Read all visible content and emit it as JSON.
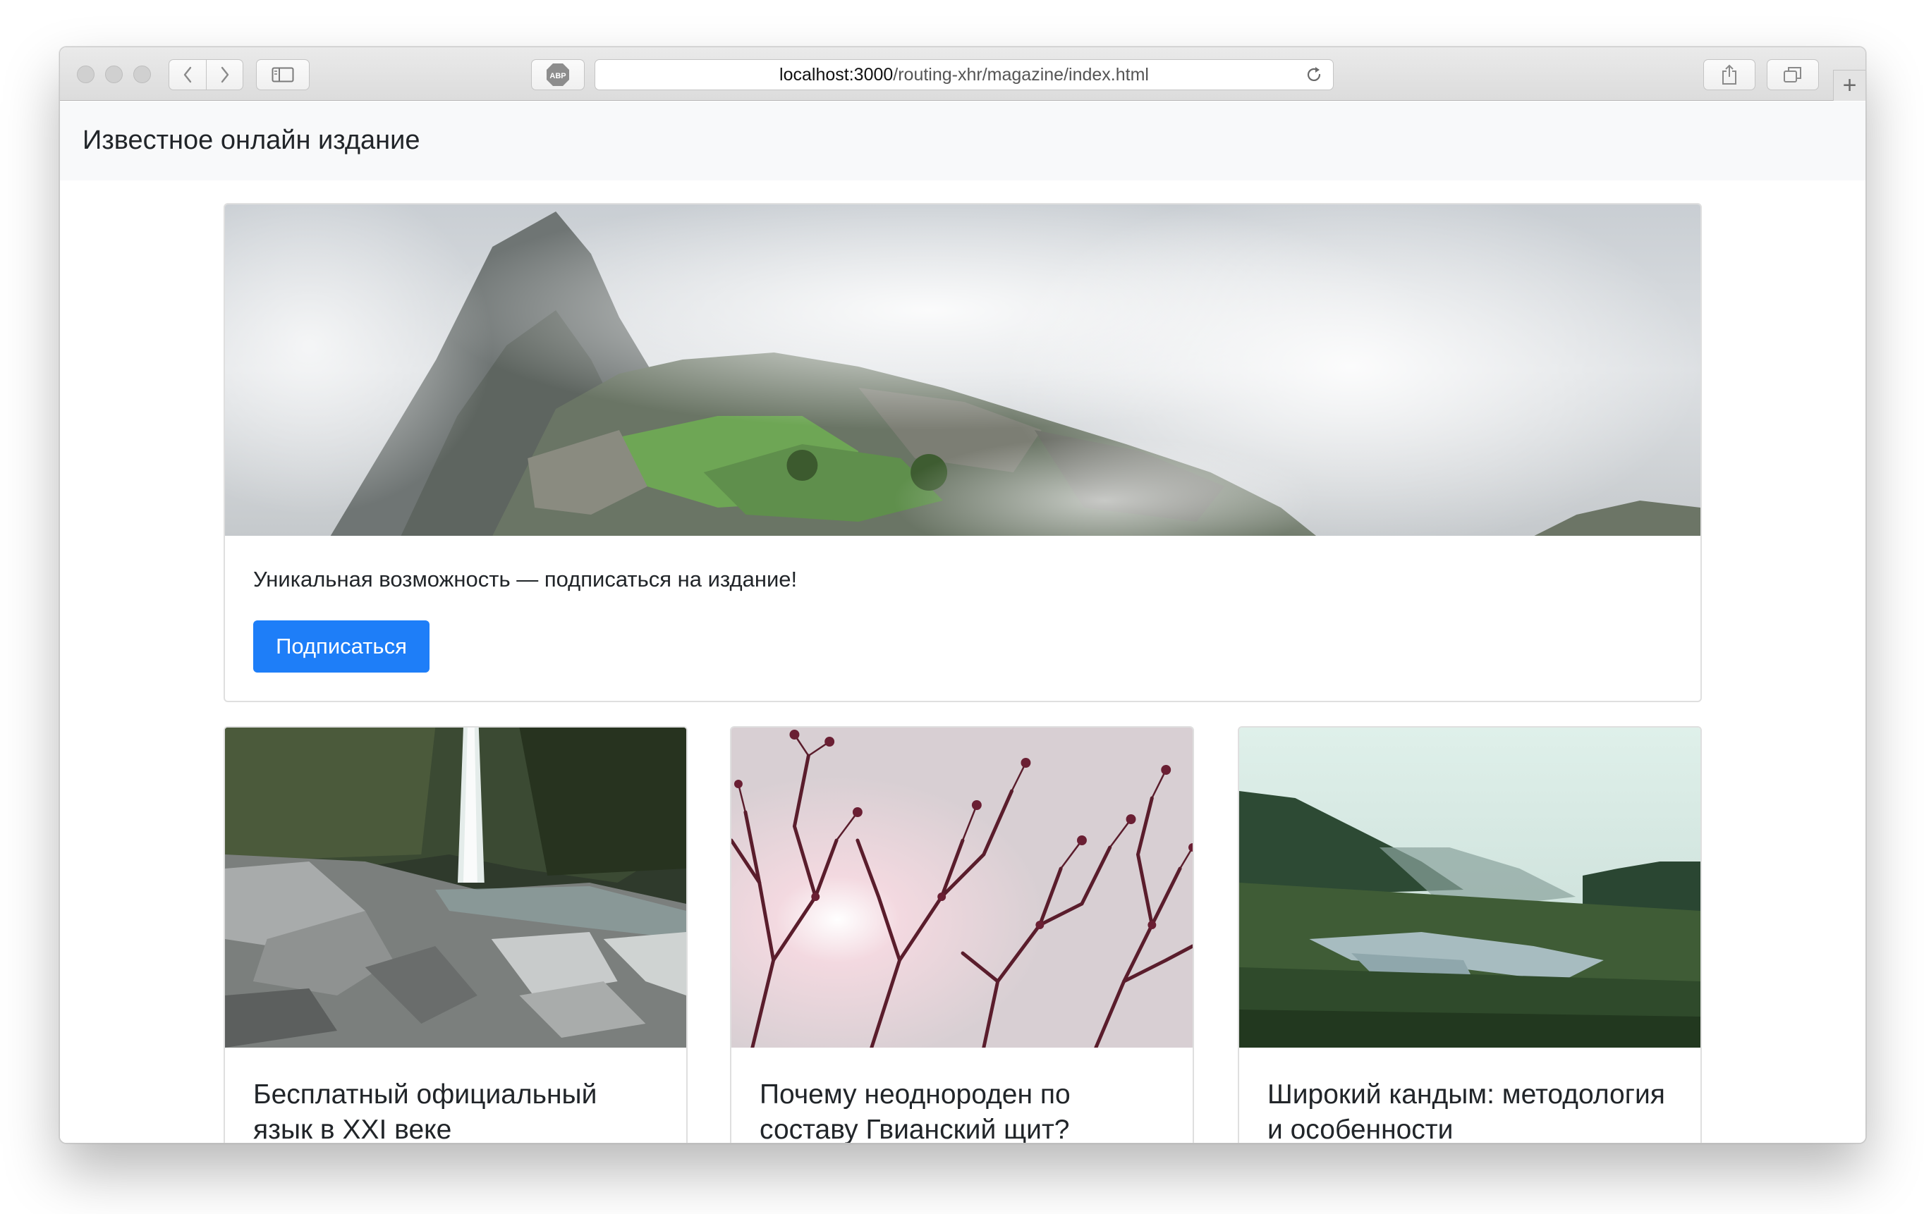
{
  "browser": {
    "url_host": "localhost:3000",
    "url_path": "/routing-xhr/magazine/index.html",
    "adblock_label": "ABP",
    "new_tab_label": "+"
  },
  "navbar": {
    "brand": "Известное онлайн издание"
  },
  "hero": {
    "text": "Уникальная возможность — подписаться на издание!",
    "button_label": "Подписаться"
  },
  "articles": [
    {
      "title": "Бесплатный официальный язык в XXI веке"
    },
    {
      "title": "Почему неоднороден по составу Гвианский щит?"
    },
    {
      "title": "Широкий кандым: методология и особенности"
    }
  ],
  "colors": {
    "primary_button": "#1e7ef8",
    "navbar_bg": "#f8f9fa"
  }
}
